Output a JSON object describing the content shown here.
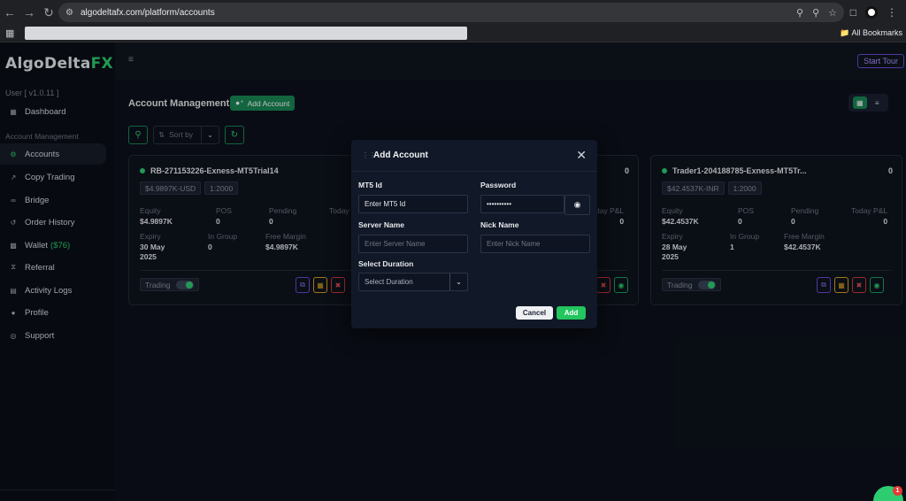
{
  "browser": {
    "url": "algodeltafx.com/platform/accounts",
    "all_bookmarks": "All Bookmarks"
  },
  "brand": {
    "name_main": "AlgoDelta",
    "name_accent": "FX"
  },
  "user": {
    "version_label": "User  [ v1.0.11 ]"
  },
  "sidebar": {
    "dashboard": "Dashboard",
    "section_label": "Account Management",
    "items": [
      {
        "label": "Accounts"
      },
      {
        "label": "Copy Trading"
      },
      {
        "label": "Bridge"
      },
      {
        "label": "Order History"
      },
      {
        "label": "Wallet",
        "extra": "($76)"
      },
      {
        "label": "Referral"
      },
      {
        "label": "Activity Logs"
      },
      {
        "label": "Profile"
      },
      {
        "label": "Support"
      }
    ]
  },
  "topbar": {
    "start_tour": "Start Tour"
  },
  "page": {
    "title": "Account Management",
    "add_account": "Add Account",
    "sort_placeholder": "Sort by"
  },
  "cards": [
    {
      "title": "RB-271153226-Exness-MT5Trial14",
      "count": "0",
      "balance_chip": "$4.9897K-USD",
      "leverage_chip": "1:2000",
      "equity_label": "Equity",
      "equity": "$4.9897K",
      "pos_label": "POS",
      "pos": "0",
      "pending_label": "Pending",
      "pending": "0",
      "today_label": "Today",
      "expiry_label": "Expiry",
      "expiry_line1": "30 May",
      "expiry_line2": "2025",
      "in_group_label": "In Group",
      "in_group": "0",
      "free_margin_label": "Free Margin",
      "free_margin": "$4.9897K",
      "trading_label": "Trading"
    },
    {
      "count": "0",
      "today_label": "day P&L",
      "today": "0"
    },
    {
      "title": "Trader1-204188785-Exness-MT5Tr...",
      "count": "0",
      "balance_chip": "$42.4537K-INR",
      "leverage_chip": "1:2000",
      "equity_label": "Equity",
      "equity": "$42.4537K",
      "pos_label": "POS",
      "pos": "0",
      "pending_label": "Pending",
      "pending": "0",
      "today_label": "Today P&L",
      "today": "0",
      "expiry_label": "Expiry",
      "expiry_line1": "28 May",
      "expiry_line2": "2025",
      "in_group_label": "In Group",
      "in_group": "1",
      "free_margin_label": "Free Margin",
      "free_margin": "$42.4537K",
      "trading_label": "Trading"
    }
  ],
  "modal": {
    "title": "Add Account",
    "mt5_label": "MT5 Id",
    "mt5_value": "Enter MT5 Id",
    "password_label": "Password",
    "password_value": "••••••••••",
    "server_label": "Server Name",
    "server_placeholder": "Enter Server Name",
    "nick_label": "Nick Name",
    "nick_placeholder": "Enter Nick Name",
    "duration_label": "Select Duration",
    "duration_value": "Select Duration",
    "cancel": "Cancel",
    "add": "Add"
  },
  "chat": {
    "badge": "1"
  },
  "colors": {
    "accent": "#22c55e",
    "brand_green": "#198754",
    "purple": "#6a4bd6"
  }
}
